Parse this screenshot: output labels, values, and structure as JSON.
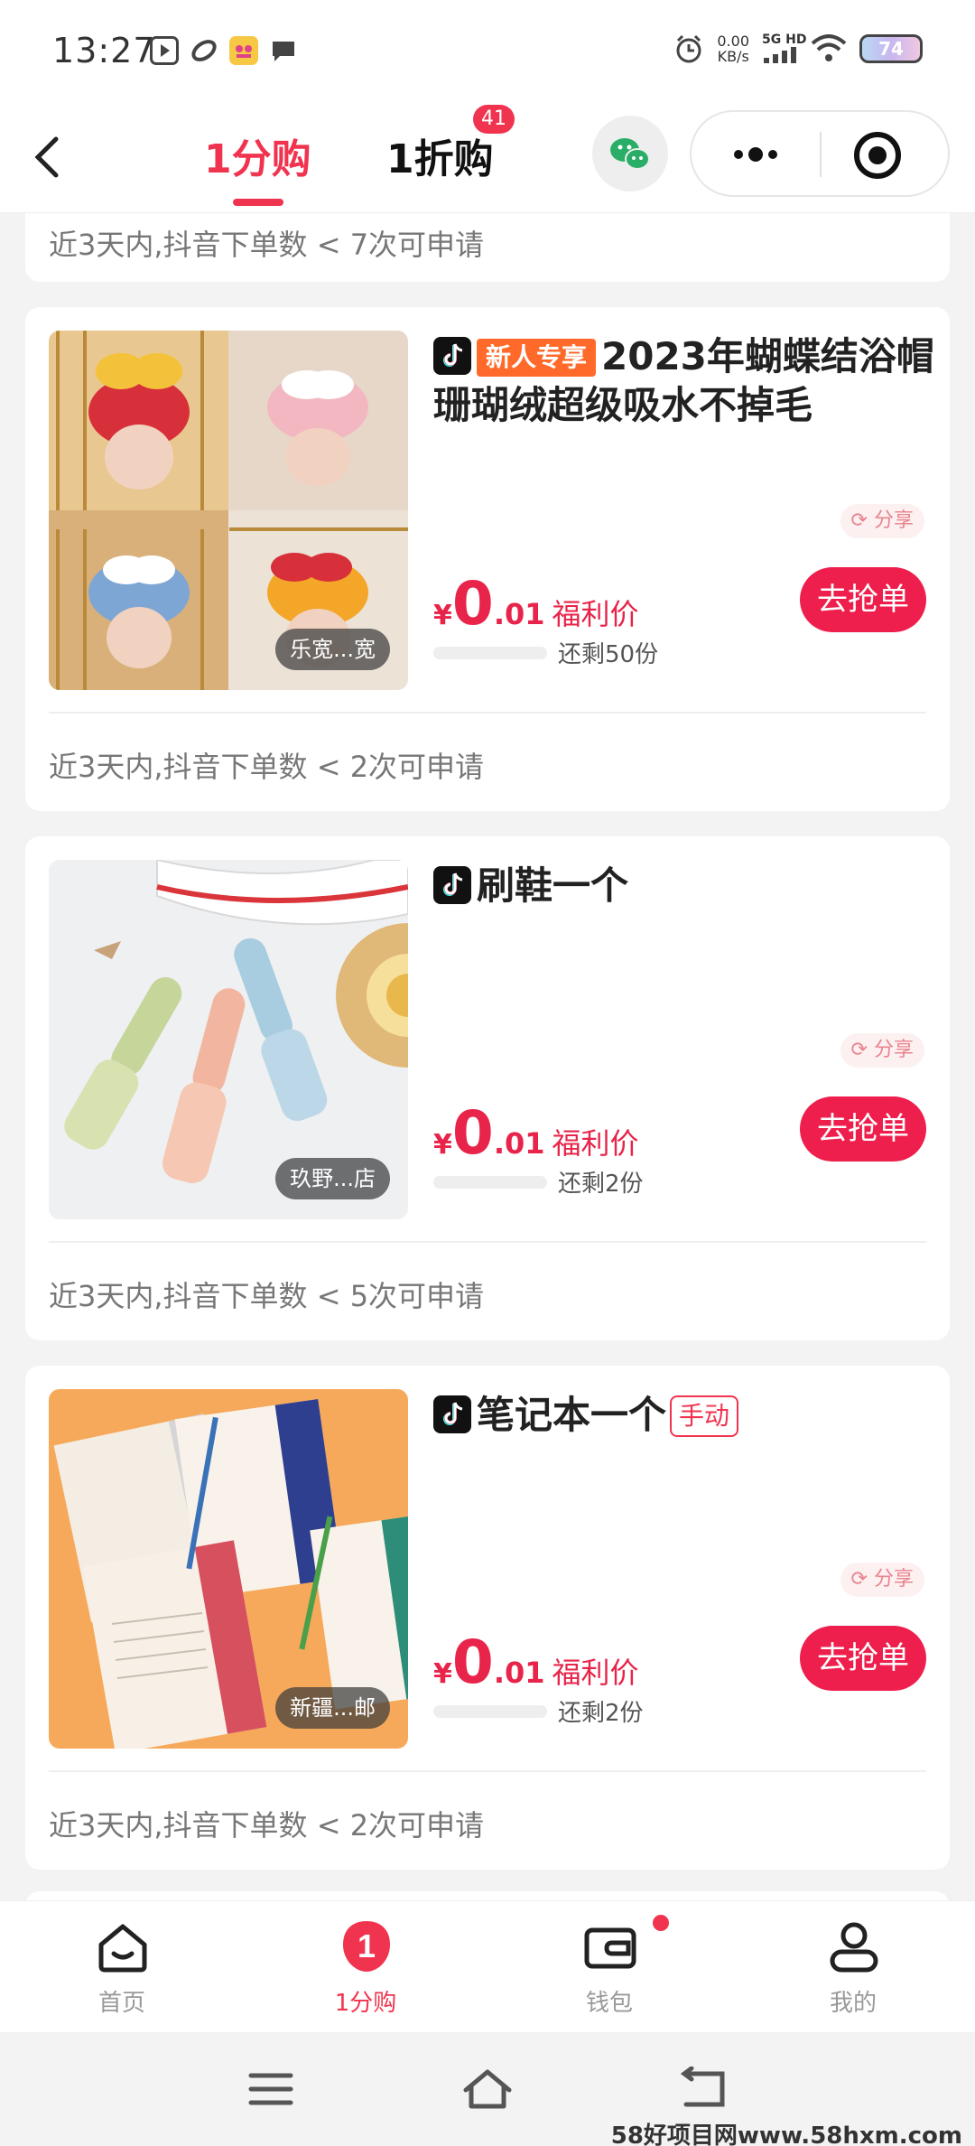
{
  "status_bar": {
    "time": "13:27",
    "net_speed_value": "0.00",
    "net_speed_unit": "KB/s",
    "network": "5G HD",
    "battery": "74"
  },
  "nav": {
    "tab_active": "1分购",
    "tab_other": "1折购",
    "tab_badge": "41"
  },
  "condition_top": "近3天内,抖音下单数 < 7次可申请",
  "products": [
    {
      "new_tag": "新人专享",
      "title": "2023年蝴蝶结浴帽珊瑚绒超级吸水不掉毛",
      "store": "乐宽...宽",
      "share": "分享",
      "price_symbol": "¥",
      "price_int": "0",
      "price_dec": ".01",
      "price_label": "福利价",
      "remaining": "还剩50份",
      "progress": 0.0,
      "button": "去抢单",
      "condition": "近3天内,抖音下单数 < 2次可申请"
    },
    {
      "title": "刷鞋一个",
      "store": "玖野...店",
      "share": "分享",
      "price_symbol": "¥",
      "price_int": "0",
      "price_dec": ".01",
      "price_label": "福利价",
      "remaining": "还剩2份",
      "progress": 0.0,
      "button": "去抢单",
      "condition": "近3天内,抖音下单数 < 5次可申请"
    },
    {
      "title": "笔记本一个",
      "manual_tag": "手动",
      "store": "新疆...邮",
      "share": "分享",
      "price_symbol": "¥",
      "price_int": "0",
      "price_dec": ".01",
      "price_label": "福利价",
      "remaining": "还剩2份",
      "progress": 0.0,
      "button": "去抢单",
      "condition": "近3天内,抖音下单数 < 2次可申请"
    }
  ],
  "tabbar": {
    "items": [
      {
        "label": "首页",
        "icon": "home-icon"
      },
      {
        "label": "1分购",
        "icon": "one-cent-icon",
        "badge_text": "1"
      },
      {
        "label": "钱包",
        "icon": "wallet-icon"
      },
      {
        "label": "我的",
        "icon": "profile-icon"
      }
    ]
  },
  "watermark": "58好项目网www.58hxm.com",
  "colors": {
    "accent": "#f0344f",
    "button": "#ee1f4c",
    "new_tag": "#ff6a2a"
  }
}
